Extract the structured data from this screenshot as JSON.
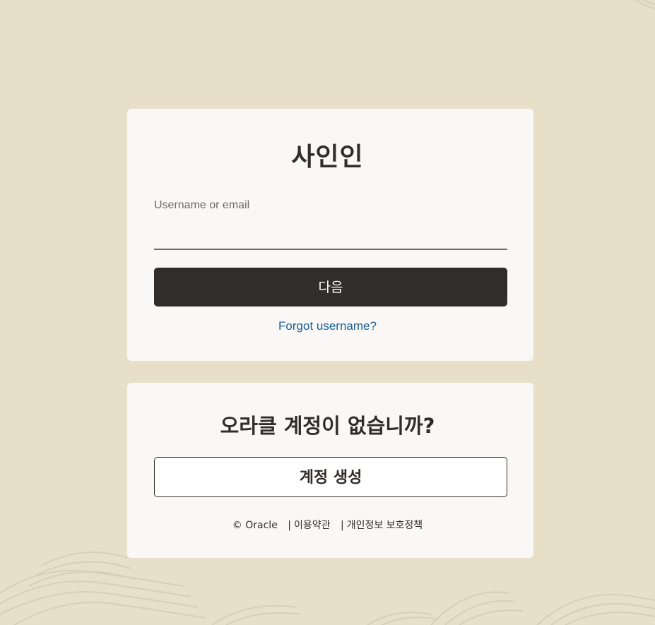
{
  "signin": {
    "title": "사인인",
    "username_label": "Username or email",
    "username_value": "",
    "next_button": "다음",
    "forgot_link": "Forgot username?"
  },
  "create_account": {
    "title": "오라클 계정이 없습니까?",
    "button": "계정 생성"
  },
  "footer": {
    "copyright": "© Oracle",
    "separator": "|",
    "terms": "이용약관",
    "privacy": "개인정보 보호정책"
  },
  "colors": {
    "background": "#e8dfc8",
    "card": "#f9f8f6",
    "primary_button": "#312d2a",
    "link": "#1b5f93"
  }
}
